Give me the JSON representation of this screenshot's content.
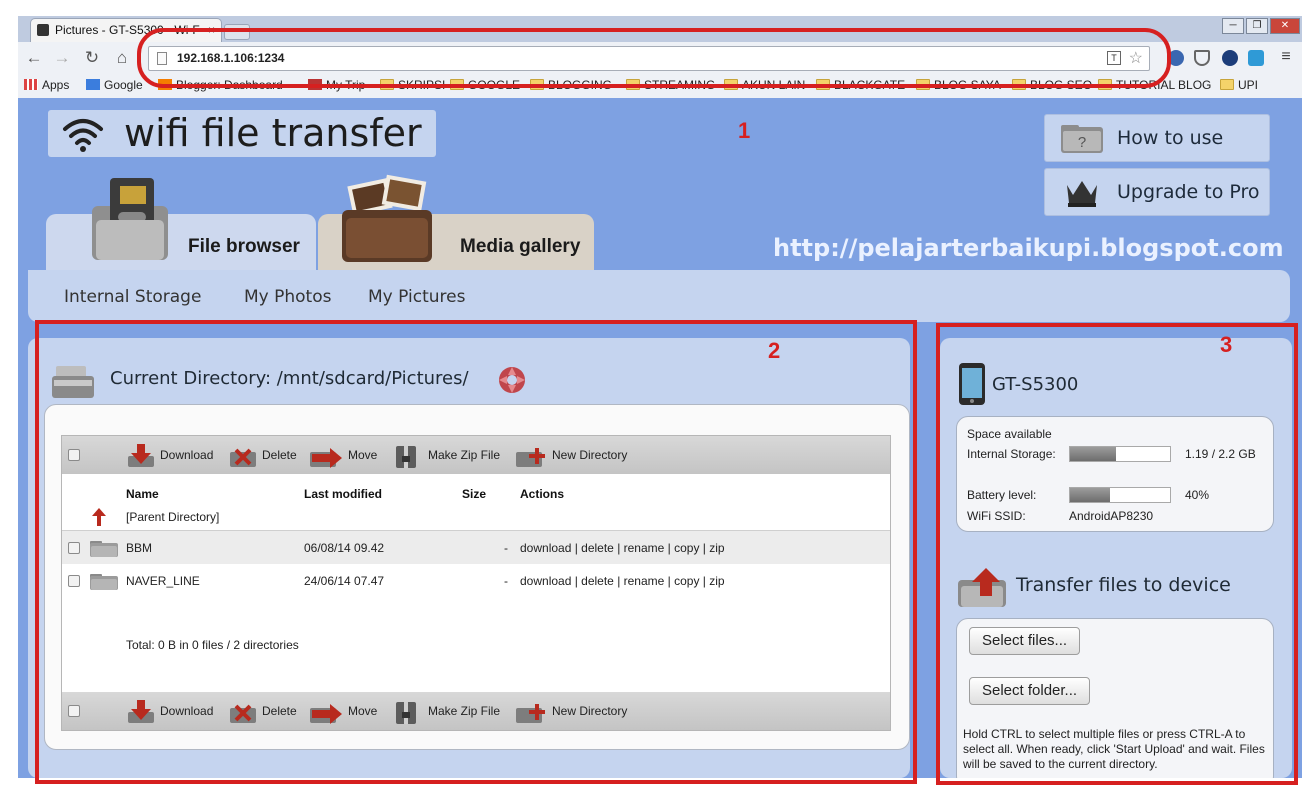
{
  "browser": {
    "tab_title": "Pictures - GT-S5300 - Wi-F",
    "tab_close": "×",
    "url": "192.168.1.106:1234",
    "translate_icon": "translate-icon",
    "window_buttons": [
      "─",
      "❐",
      "✕"
    ],
    "nav": {
      "back": "←",
      "forward": "→",
      "reload": "↻",
      "home": "⌂"
    },
    "star": "☆"
  },
  "bookmarks": [
    "Apps",
    "Google",
    "Blogger: Dashboard",
    "My Trip",
    "SKRIPSI",
    "GOOGLE",
    "BLOGGING",
    "STREAMING",
    "AKUN LAIN",
    "BLACKGATE",
    "BLOG SAYA",
    "BLOG SEO",
    "TUTORIAL BLOG",
    "UPI"
  ],
  "app": {
    "title": "wifi file transfer",
    "how_to_use": "How to use",
    "upgrade": "Upgrade to Pro",
    "blog_url": "http://pelajarterbaikupi.blogspot.com",
    "tabs": [
      "File browser",
      "Media gallery"
    ],
    "subnav": [
      "Internal Storage",
      "My Photos",
      "My Pictures"
    ]
  },
  "annotations": [
    "1",
    "2",
    "3"
  ],
  "file_browser": {
    "current_dir_label": "Current Directory:",
    "current_dir": "/mnt/sdcard/Pictures/",
    "actions": [
      "Download",
      "Delete",
      "Move",
      "Make Zip File",
      "New Directory"
    ],
    "headers": [
      "Name",
      "Last modified",
      "Size",
      "Actions"
    ],
    "parent": "[Parent Directory]",
    "rows": [
      {
        "name": "BBM",
        "modified": "06/08/14 09.42",
        "size": "-",
        "actions": "download | delete | rename | copy | zip"
      },
      {
        "name": "NAVER_LINE",
        "modified": "24/06/14 07.47",
        "size": "-",
        "actions": "download | delete | rename | copy | zip"
      }
    ],
    "total": "Total: 0 B in 0 files / 2 directories"
  },
  "device": {
    "name": "GT-S5300",
    "space_label": "Space available",
    "storage_label": "Internal Storage:",
    "storage_value": "1.19 / 2.2 GB",
    "storage_fraction": 0.46,
    "battery_label": "Battery level:",
    "battery_value": "40%",
    "battery_fraction": 0.4,
    "ssid_label": "WiFi SSID:",
    "ssid_value": "AndroidAP8230"
  },
  "transfer": {
    "title": "Transfer files to device",
    "select_files": "Select files...",
    "select_folder": "Select folder...",
    "help": "Hold CTRL to select multiple files or press CTRL-A to select all. When ready, click 'Start Upload' and wait. Files will be saved to the current directory."
  },
  "colors": {
    "accent_red": "#d62020",
    "page_bg": "#7ea1e2",
    "panel_bg": "#c5d4ef"
  }
}
